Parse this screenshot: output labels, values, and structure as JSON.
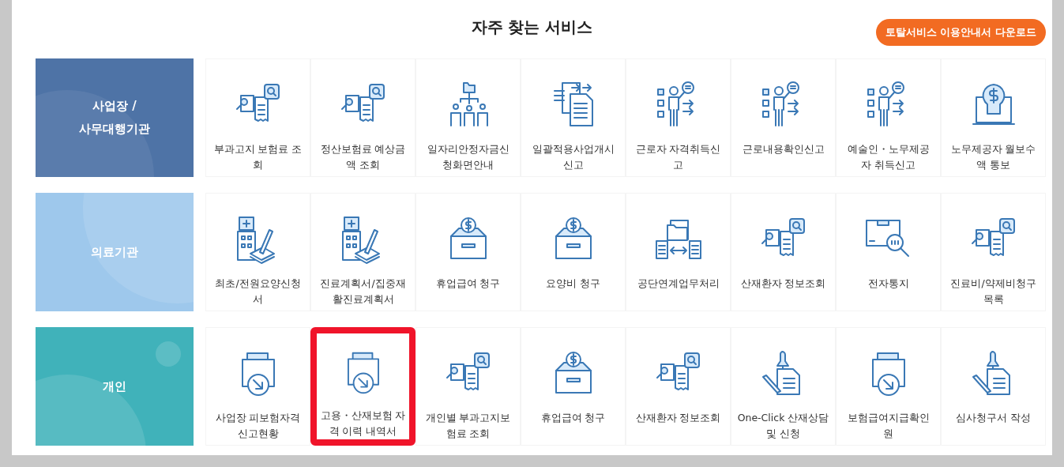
{
  "title": "자주 찾는 서비스",
  "download_button": "토탈서비스 이용안내서 다운로드",
  "groups": [
    {
      "kind": "business",
      "label_lines": [
        "사업장 /",
        "사무대행기관"
      ],
      "items": [
        {
          "label": "부과고지 보험료 조회",
          "highlighted": false
        },
        {
          "label": "정산보험료 예상금액 조회",
          "highlighted": false
        },
        {
          "label": "일자리안정자금신청화면안내",
          "highlighted": false
        },
        {
          "label": "일괄적용사업개시신고",
          "highlighted": false
        },
        {
          "label": "근로자 자격취득신고",
          "highlighted": false
        },
        {
          "label": "근로내용확인신고",
          "highlighted": false
        },
        {
          "label": "예술인・노무제공자 취득신고",
          "highlighted": false
        },
        {
          "label": "노무제공자 월보수액 통보",
          "highlighted": false
        }
      ]
    },
    {
      "kind": "medical",
      "label_lines": [
        "의료기관"
      ],
      "items": [
        {
          "label": "최초/전원요양신청서",
          "highlighted": false
        },
        {
          "label": "진료계획서/집중재활진료계획서",
          "highlighted": false
        },
        {
          "label": "휴업급여 청구",
          "highlighted": false
        },
        {
          "label": "요양비 청구",
          "highlighted": false
        },
        {
          "label": "공단연계업무처리",
          "highlighted": false
        },
        {
          "label": "산재환자 정보조회",
          "highlighted": false
        },
        {
          "label": "전자통지",
          "highlighted": false
        },
        {
          "label": "진료비/약제비청구목록",
          "highlighted": false
        }
      ]
    },
    {
      "kind": "personal",
      "label_lines": [
        "개인"
      ],
      "items": [
        {
          "label": "사업장 피보험자격신고현황",
          "highlighted": false
        },
        {
          "label": "고용・산재보험 자격 이력 내역서",
          "highlighted": true
        },
        {
          "label": "개인별 부과고지보험료 조회",
          "highlighted": false
        },
        {
          "label": "휴업급여 청구",
          "highlighted": false
        },
        {
          "label": "산재환자 정보조회",
          "highlighted": false
        },
        {
          "label": "One-Click 산재상담 및 신청",
          "highlighted": false
        },
        {
          "label": "보험급여지급확인원",
          "highlighted": false
        },
        {
          "label": "심사청구서 작성",
          "highlighted": false
        }
      ]
    }
  ]
}
